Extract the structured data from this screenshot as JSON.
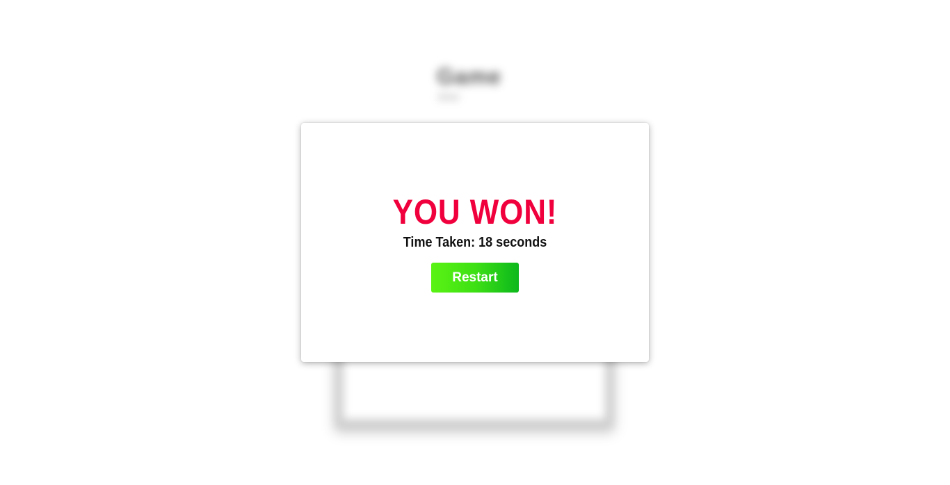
{
  "background": {
    "title": "Game",
    "subtitle": "timer"
  },
  "modal": {
    "title": "YOU WON!",
    "time_label": "Time Taken:",
    "time_value": "18",
    "time_unit": "seconds",
    "restart_label": "Restart"
  },
  "colors": {
    "title": "#f0003c",
    "button_start": "#5af314",
    "button_end": "#0cb81c"
  }
}
